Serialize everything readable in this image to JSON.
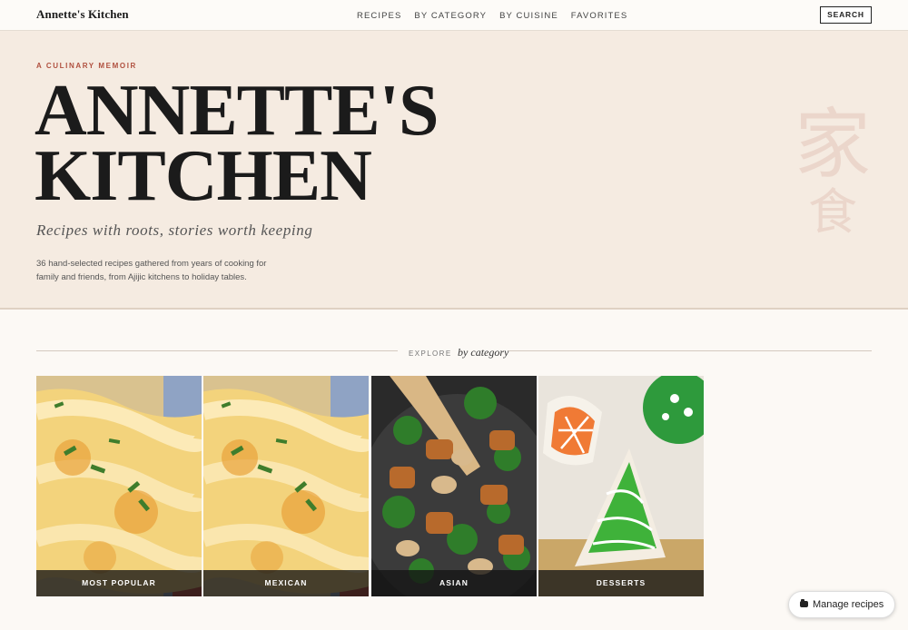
{
  "nav": {
    "brand": "Annette's Kitchen",
    "links": [
      "RECIPES",
      "BY CATEGORY",
      "BY CUISINE",
      "FAVORITES"
    ],
    "search_label": "SEARCH"
  },
  "hero": {
    "eyebrow": "A CULINARY MEMOIR",
    "title_line1": "ANNETTE'S",
    "title_line2": "KITCHEN",
    "tagline": "Recipes with roots, stories worth keeping",
    "description": "36 hand-selected recipes gathered from years of cooking for family and friends, from Ajijic kitchens to holiday tables.",
    "watermark_large": "家",
    "watermark_small": "食"
  },
  "explore": {
    "prefix": "EXPLORE",
    "suffix": "by category"
  },
  "categories": [
    {
      "label": "MOST POPULAR",
      "image": "enchiladas-photo"
    },
    {
      "label": "MEXICAN",
      "image": "enchiladas-photo"
    },
    {
      "label": "ASIAN",
      "image": "stir-fry-photo"
    },
    {
      "label": "DESSERTS",
      "image": "decorated-cookies-photo"
    }
  ],
  "manage_button": {
    "label": "Manage recipes",
    "icon": "folder-icon"
  },
  "colors": {
    "hero_bg": "#f5ebe1",
    "accent": "#b0503f",
    "page_bg": "#fcf9f5"
  }
}
